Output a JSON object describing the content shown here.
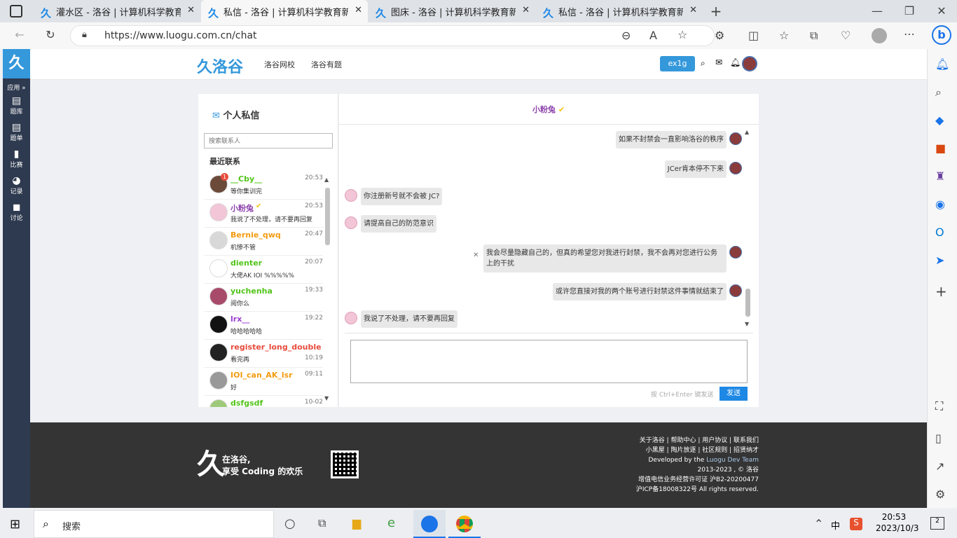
{
  "browser": {
    "tabs": [
      {
        "title": "灌水区 - 洛谷 | 计算机科学教育新",
        "active": false
      },
      {
        "title": "私信 - 洛谷 | 计算机科学教育新生",
        "active": true
      },
      {
        "title": "图床 - 洛谷 | 计算机科学教育新生",
        "active": false
      },
      {
        "title": "私信 - 洛谷 | 计算机科学教育新生",
        "active": false
      }
    ],
    "url": "https://www.luogu.com.cn/chat"
  },
  "sidebar": {
    "logo": "久",
    "apps_label": "应用 »",
    "items": [
      {
        "label": "题库",
        "icon": "book-icon"
      },
      {
        "label": "题单",
        "icon": "list-icon"
      },
      {
        "label": "比赛",
        "icon": "bar-chart-icon"
      },
      {
        "label": "记录",
        "icon": "pie-icon"
      },
      {
        "label": "讨论",
        "icon": "chat-icon"
      }
    ]
  },
  "header": {
    "brand": "洛谷",
    "nav": [
      "洛谷网校",
      "洛谷有题"
    ],
    "ext_button": "ex1g"
  },
  "chat": {
    "panel_title": "个人私信",
    "search_placeholder": "搜索联系人",
    "recent_label": "最近联系",
    "contacts": [
      {
        "name": "__Cby__",
        "time": "20:53",
        "msg": "等你集训完",
        "color": "#52c41a",
        "badge": "1",
        "av": "#6b4a3a"
      },
      {
        "name": "小粉兔",
        "time": "20:53",
        "msg": "我说了不处理，请不要再回复",
        "color": "#8e44ad",
        "verified": true,
        "av": "#f2c6d6"
      },
      {
        "name": "Bernie_qwq",
        "time": "20:47",
        "msg": "机惨不管",
        "color": "#f39c11",
        "av": "#d8d8d8"
      },
      {
        "name": "dienter",
        "time": "20:07",
        "msg": "大佬AK IOI %%%%%",
        "color": "#52c41a",
        "av": "#ffffff"
      },
      {
        "name": "yuchenha",
        "time": "19:33",
        "msg": "阅你么",
        "color": "#52c41a",
        "av": "#a84a6a"
      },
      {
        "name": "lrx__",
        "time": "19:22",
        "msg": "哈哈哈哈哈",
        "color": "#9d3dcf",
        "av": "#111111"
      },
      {
        "name": "register_long_double",
        "time": "10:19",
        "msg": "看完再",
        "color": "#e74c3c",
        "av": "#222222"
      },
      {
        "name": "IOI_can_AK_lsr",
        "time": "09:11",
        "msg": "好",
        "color": "#f39c11",
        "av": "#999999"
      },
      {
        "name": "dsfgsdf",
        "time": "10-02",
        "msg": "",
        "color": "#52c41a",
        "av": "#9fc97a"
      }
    ],
    "peer_name": "小粉兔",
    "messages": [
      {
        "text": "如果不封禁会一直影响洛谷的秩序",
        "mine": true
      },
      {
        "text": "JCer肯本停不下来",
        "mine": true
      },
      {
        "text": "你注册新号就不会被 JC?",
        "mine": false
      },
      {
        "text": "请提高自己的防范意识",
        "mine": false
      },
      {
        "text": "我会尽量隐藏自己的，但真的希望您对我进行封禁，我不会再对您进行公务上的干扰",
        "mine": true,
        "failed": true
      },
      {
        "text": "或许您直接对我的两个账号进行封禁这件事情就结束了",
        "mine": true
      },
      {
        "text": "我说了不处理，请不要再回复",
        "mine": false
      }
    ],
    "send_hint": "按 Ctrl+Enter 键发送",
    "send_label": "发送"
  },
  "footer": {
    "slogan1": "在洛谷,",
    "slogan2": "享受 Coding 的欢乐",
    "links1": "关于洛谷 | 帮助中心 | 用户协议 | 联系我们",
    "links2": "小黑屋 | 陶片放逐 | 社区规则 | 招贤纳才",
    "dev_prefix": "Developed by the ",
    "dev_team": "Luogu Dev Team",
    "copyright": "2013-2023 , © 洛谷",
    "icp1": "增值电信业务经营许可证 沪B2-20200477",
    "icp2": "沪ICP备18008322号 All rights reserved."
  },
  "taskbar": {
    "search": "搜索",
    "ime": "中",
    "time": "20:53",
    "date": "2023/10/3",
    "notif": "2"
  }
}
